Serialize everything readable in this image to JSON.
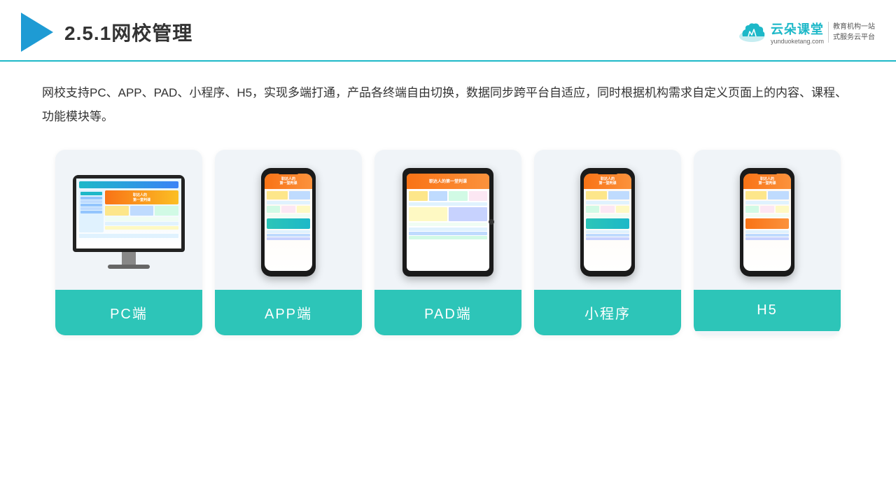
{
  "header": {
    "section_number": "2.5.1",
    "title": "网校管理",
    "brand": {
      "name": "云朵课堂",
      "url": "yunduoketang.com",
      "slogan_line1": "教育机构一站",
      "slogan_line2": "式服务云平台"
    }
  },
  "description": "网校支持PC、APP、PAD、小程序、H5，实现多端打通，产品各终端自由切换，数据同步跨平台自适应，同时根据机构需求自定义页面上的内容、课程、功能模块等。",
  "cards": [
    {
      "id": "pc",
      "label": "PC端"
    },
    {
      "id": "app",
      "label": "APP端"
    },
    {
      "id": "pad",
      "label": "PAD端"
    },
    {
      "id": "miniprogram",
      "label": "小程序"
    },
    {
      "id": "h5",
      "label": "H5"
    }
  ],
  "colors": {
    "accent": "#2dc5b8",
    "header_line": "#1db8c8",
    "brand_color": "#1db8c8"
  }
}
